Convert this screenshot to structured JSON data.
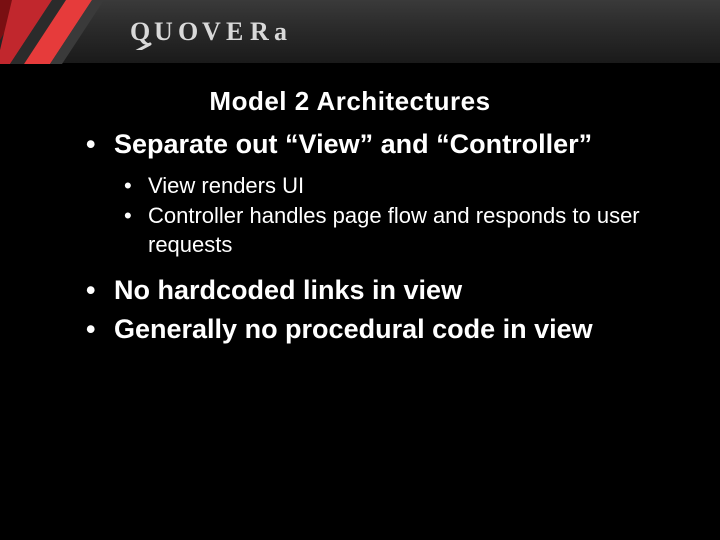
{
  "brand": "QUOVERA",
  "title": "Model 2 Architectures",
  "bullets": [
    {
      "text": "Separate out “View” and “Controller”",
      "children": [
        "View renders UI",
        "Controller handles page flow and responds to user requests"
      ]
    },
    {
      "text": "No hardcoded links in view",
      "children": []
    },
    {
      "text": "Generally no procedural code in view",
      "children": []
    }
  ]
}
